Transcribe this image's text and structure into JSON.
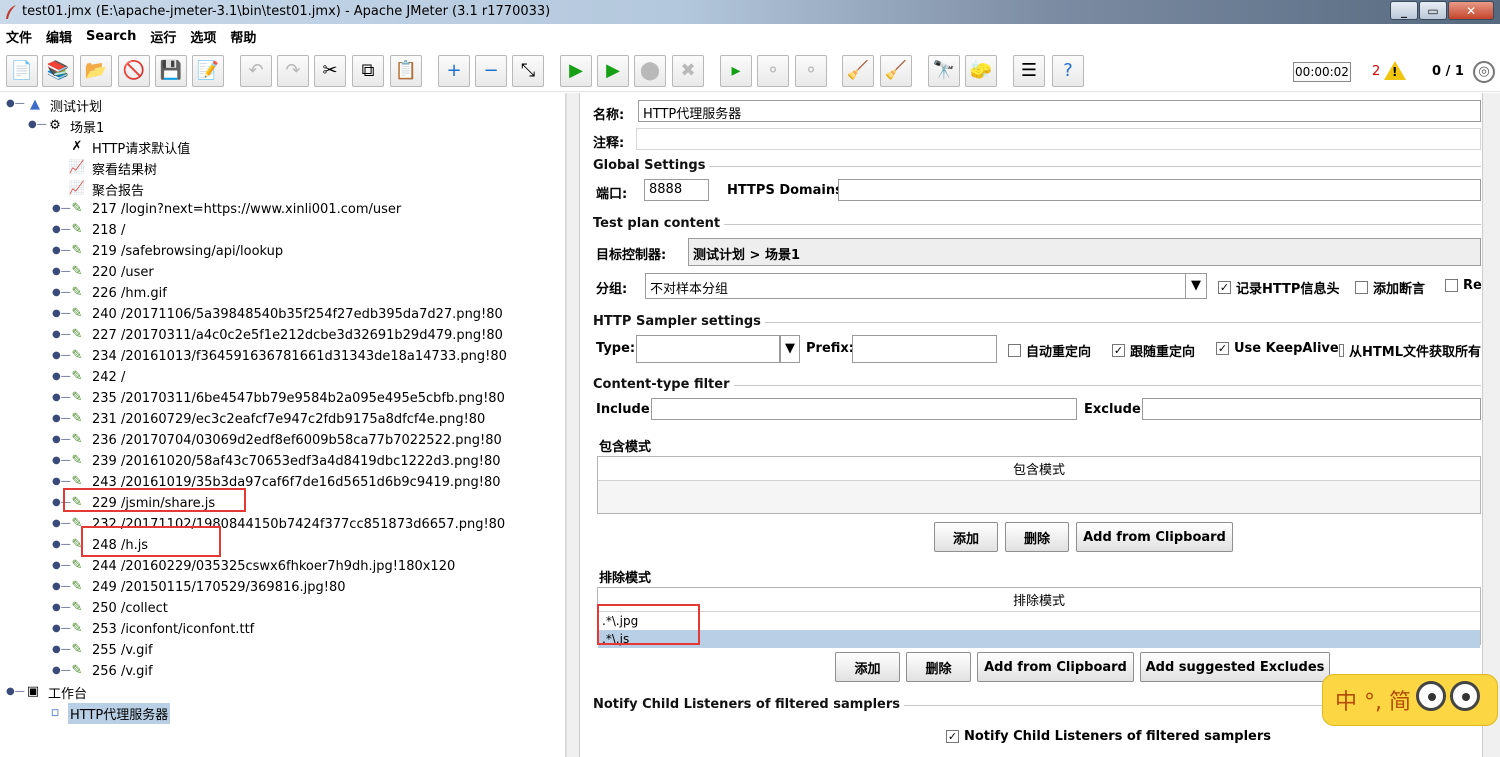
{
  "window": {
    "title": "test01.jmx (E:\\apache-jmeter-3.1\\bin\\test01.jmx) - Apache JMeter (3.1 r1770033)"
  },
  "menu": [
    "文件",
    "编辑",
    "Search",
    "运行",
    "选项",
    "帮助"
  ],
  "status": {
    "timer": "00:00:02",
    "errors": "2",
    "threads": "0 / 1"
  },
  "tree": {
    "test_plan": "测试计划",
    "thread_group": "场景1",
    "config": "HTTP请求默认值",
    "listeners": [
      "察看结果树",
      "聚合报告"
    ],
    "samplers": [
      "217 /login?next=https://www.xinli001.com/user",
      "218 /",
      "219 /safebrowsing/api/lookup",
      "220 /user",
      "226 /hm.gif",
      "240 /20171106/5a39848540b35f254f27edb395da7d27.png!80",
      "227 /20170311/a4c0c2e5f1e212dcbe3d32691b29d479.png!80",
      "234 /20161013/f364591636781661d31343de18a14733.png!80",
      "242 /",
      "235 /20170311/6be4547bb79e9584b2a095e495e5cbfb.png!80",
      "231 /20160729/ec3c2eafcf7e947c2fdb9175a8dfcf4e.png!80",
      "236 /20170704/03069d2edf8ef6009b58ca77b7022522.png!80",
      "239 /20161020/58af43c70653edf3a4d8419dbc1222d3.png!80",
      "243 /20161019/35b3da97caf6f7de16d5651d6b9c9419.png!80",
      "229 /jsmin/share.js",
      "232 /20171102/1980844150b7424f377cc851873d6657.png!80",
      "248 /h.js",
      "244 /20160229/035325cswx6fhkoer7h9dh.jpg!180x120",
      "249 /20150115/170529/369816.jpg!80",
      "250 /collect",
      "253 /iconfont/iconfont.ttf",
      "255 /v.gif",
      "256 /v.gif"
    ],
    "workbench": "工作台",
    "proxy": "HTTP代理服务器"
  },
  "panel": {
    "name_label": "名称:",
    "name_value": "HTTP代理服务器",
    "comment_label": "注释:",
    "global_settings": {
      "title": "Global Settings",
      "port_label": "端口:",
      "port_value": "8888",
      "https_label": "HTTPS Domains :"
    },
    "test_plan_content": {
      "title": "Test plan content",
      "target_label": "目标控制器:",
      "target_value": "测试计划 > 场景1",
      "group_label": "分组:",
      "group_value": "不对样本分组",
      "record_headers": "记录HTTP信息头",
      "add_assertions": "添加断言",
      "regex_matching": "Re"
    },
    "sampler_settings": {
      "title": "HTTP Sampler settings",
      "type_label": "Type:",
      "prefix_label": "Prefix:",
      "auto_redirect": "自动重定向",
      "follow_redirects": "跟随重定向",
      "keepalive": "Use KeepAlive",
      "retrieve_embedded": "从HTML文件获取所有"
    },
    "content_filter": {
      "title": "Content-type filter",
      "include_label": "Include:",
      "exclude_label": "Exclude:"
    },
    "include_patterns": {
      "title": "包含模式",
      "column": "包含模式",
      "rows": [],
      "add": "添加",
      "delete": "删除",
      "clipboard": "Add from Clipboard"
    },
    "exclude_patterns": {
      "title": "排除模式",
      "column": "排除模式",
      "rows": [
        ".*\\.jpg",
        ".*\\.js"
      ],
      "add": "添加",
      "delete": "删除",
      "clipboard": "Add from Clipboard",
      "suggested": "Add suggested Excludes"
    },
    "notify": {
      "title": "Notify Child Listeners of filtered samplers",
      "checkbox": "Notify Child Listeners of filtered samplers"
    }
  },
  "ime": {
    "text": "中 °, 简"
  }
}
